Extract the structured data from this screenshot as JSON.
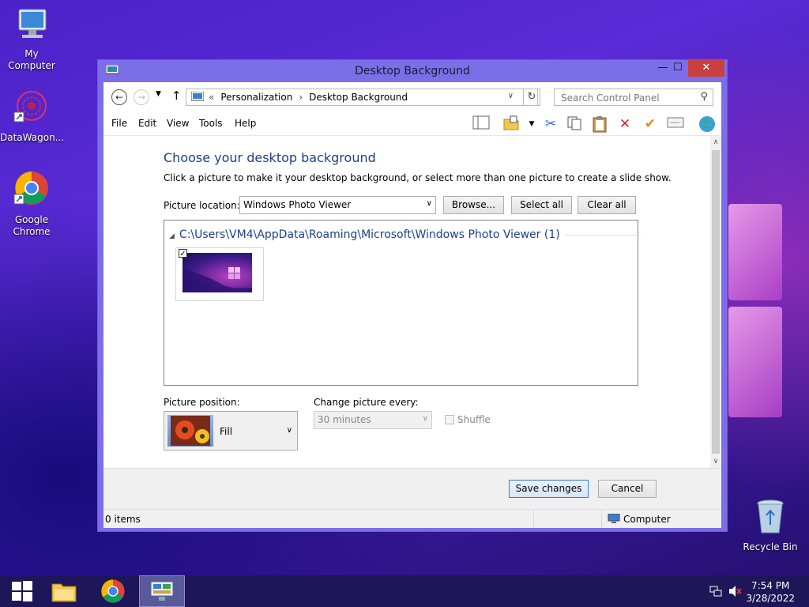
{
  "desktop": {
    "icons": [
      {
        "label": "My Computer"
      },
      {
        "label": "DataWagon..."
      },
      {
        "label": "Google Chrome"
      },
      {
        "label": "Recycle Bin"
      }
    ]
  },
  "window": {
    "title": "Desktop Background",
    "controls": {
      "minimize": "—",
      "maximize": "☐",
      "close": "✕"
    },
    "address": {
      "overflow": "«",
      "crumbs": [
        "Personalization",
        "Desktop Background"
      ],
      "separator": "›"
    },
    "search": {
      "placeholder": "Search Control Panel"
    },
    "menu": [
      "File",
      "Edit",
      "View",
      "Tools",
      "Help"
    ],
    "content": {
      "heading": "Choose your desktop background",
      "subtext": "Click a picture to make it your desktop background, or select more than one picture to create a slide show.",
      "picture_location_label": "Picture location:",
      "picture_location_value": "Windows Photo Viewer",
      "browse": "Browse...",
      "select_all": "Select all",
      "clear_all": "Clear all",
      "folder_path": "C:\\Users\\VM4\\AppData\\Roaming\\Microsoft\\Windows Photo Viewer (1)",
      "thumbnail_checked": true,
      "picture_position_label": "Picture position:",
      "picture_position_value": "Fill",
      "change_picture_label": "Change picture every:",
      "change_picture_value": "30 minutes",
      "shuffle_label": "Shuffle"
    },
    "footer": {
      "save": "Save changes",
      "cancel": "Cancel"
    },
    "status": {
      "items": "0 items",
      "location": "Computer"
    }
  },
  "taskbar": {
    "time": "7:54 PM",
    "date": "3/28/2022"
  },
  "colors": {
    "accent": "#7b6ee6",
    "heading": "#1e3e8a",
    "taskbar": "#1d1658"
  }
}
